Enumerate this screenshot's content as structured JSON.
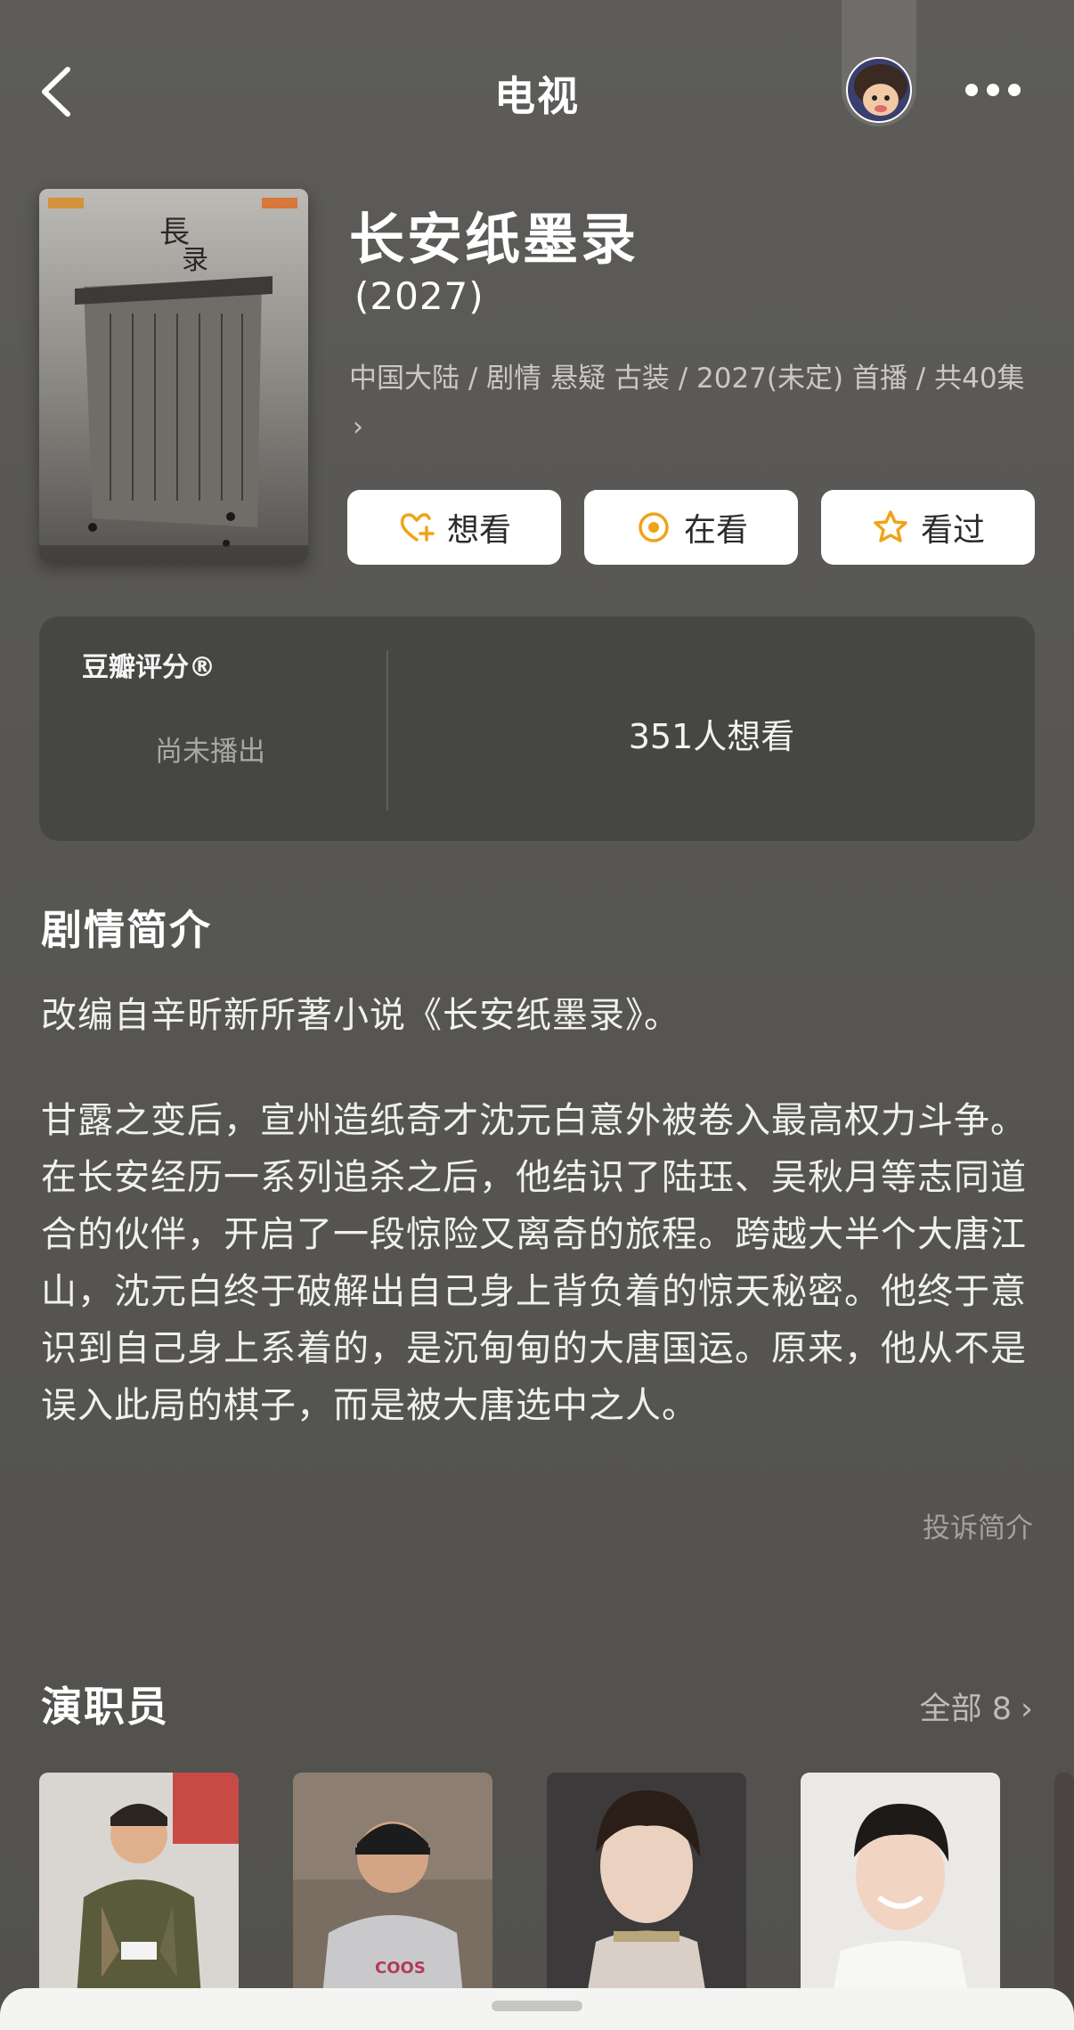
{
  "nav": {
    "title": "电视",
    "back_icon": "chevron-left-icon",
    "more_icon": "more-horizontal-icon"
  },
  "show": {
    "title": "长安纸墨录",
    "year": "(2027)",
    "meta": "中国大陆 / 剧情 悬疑 古装 / 2027(未定) 首播 / 共40集",
    "meta_chevron": "›"
  },
  "actions": [
    {
      "label": "想看",
      "icon": "heart-plus-icon"
    },
    {
      "label": "在看",
      "icon": "target-circle-icon"
    },
    {
      "label": "看过",
      "icon": "star-icon"
    }
  ],
  "rating": {
    "brand": "豆瓣评分®",
    "status": "尚未播出",
    "want_count": "351人想看"
  },
  "synopsis": {
    "heading": "剧情简介",
    "paragraphs": [
      "改编自辛昕新所著小说《长安纸墨录》。",
      "甘露之变后，宣州造纸奇才沈元白意外被卷入最高权力斗争。在长安经历一系列追杀之后，他结识了陆珏、吴秋月等志同道合的伙伴，开启了一段惊险又离奇的旅程。跨越大半个大唐江山，沈元白终于破解出自己身上背负着的惊天秘密。他终于意识到自己身上系着的，是沉甸甸的大唐国运。原来，他从不是误入此局的棋子，而是被大唐选中之人。"
    ],
    "report_label": "投诉简介"
  },
  "cast": {
    "heading": "演职员",
    "all_label": "全部 8",
    "all_chevron": "›"
  },
  "colors": {
    "accent": "#f0a318",
    "background": "#5b5a57",
    "card": "#464643"
  }
}
